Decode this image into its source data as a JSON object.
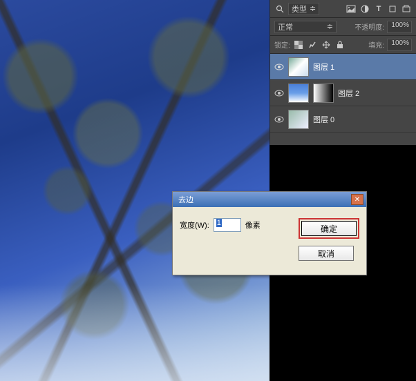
{
  "panel": {
    "filter_icon": "🔍",
    "filter_label": "类型",
    "blend_mode": "正常",
    "opacity_label": "不透明度:",
    "opacity_value": "100%",
    "lock_label": "锁定:",
    "fill_label": "填充:",
    "fill_value": "100%"
  },
  "layers": [
    {
      "name": "图层 1",
      "selected": true
    },
    {
      "name": "图层 2",
      "has_mask": true
    },
    {
      "name": "图层 0"
    }
  ],
  "dialog": {
    "title": "去边",
    "width_label": "宽度(W):",
    "width_value": "1",
    "unit": "像素",
    "ok": "确定",
    "cancel": "取消"
  }
}
